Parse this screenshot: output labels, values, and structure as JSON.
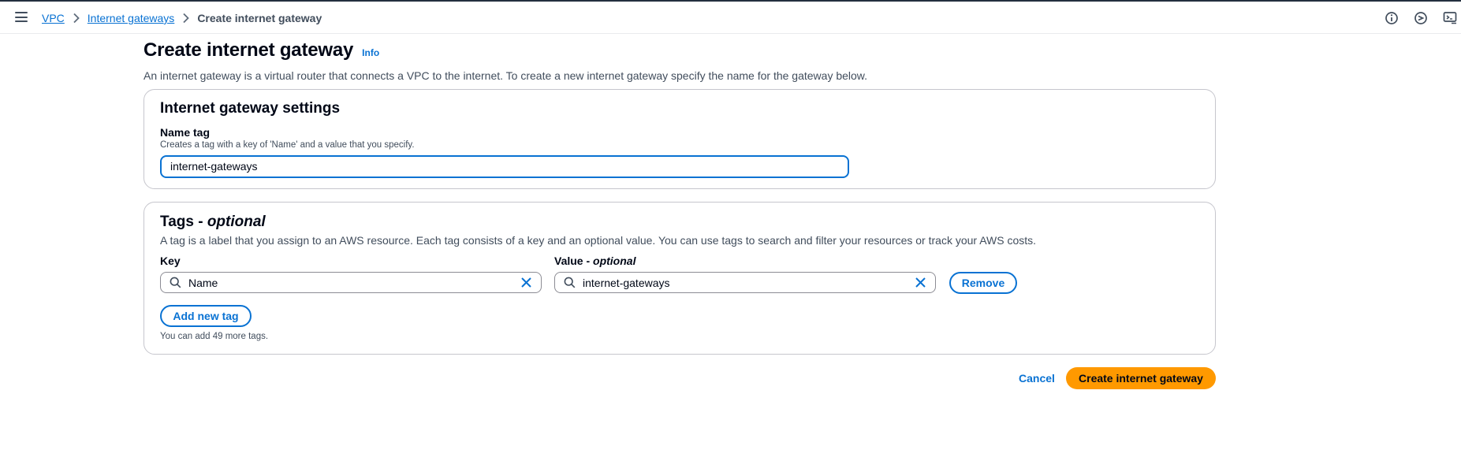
{
  "breadcrumbs": [
    {
      "label": "VPC"
    },
    {
      "label": "Internet gateways"
    },
    {
      "label": "Create internet gateway"
    }
  ],
  "topbar_icons": [
    "info-circle-icon",
    "feedback-icon",
    "cloudshell-icon"
  ],
  "page": {
    "title": "Create internet gateway",
    "info_link": "Info",
    "description": "An internet gateway is a virtual router that connects a VPC to the internet. To create a new internet gateway specify the name for the gateway below."
  },
  "settings_panel": {
    "heading": "Internet gateway settings",
    "name_tag_label": "Name tag",
    "name_tag_hint": "Creates a tag with a key of 'Name' and a value that you specify.",
    "name_tag_value": "internet-gateways"
  },
  "tags_panel": {
    "heading_main": "Tags - ",
    "heading_optional": "optional",
    "description": "A tag is a label that you assign to an AWS resource. Each tag consists of a key and an optional value. You can use tags to search and filter your resources or track your AWS costs.",
    "key_label": "Key",
    "value_label_main": "Value - ",
    "value_label_optional": "optional",
    "tags": [
      {
        "key": "Name",
        "value": "internet-gateways"
      }
    ],
    "remove_label": "Remove",
    "add_new_tag_label": "Add new tag",
    "limit_hint": "You can add 49 more tags."
  },
  "footer": {
    "cancel_label": "Cancel",
    "create_label": "Create internet gateway"
  },
  "colors": {
    "link": "#0972d3",
    "primary_button": "#ff9900",
    "text": "#000716",
    "secondary_text": "#414d5c",
    "border": "#c6c6cd"
  }
}
